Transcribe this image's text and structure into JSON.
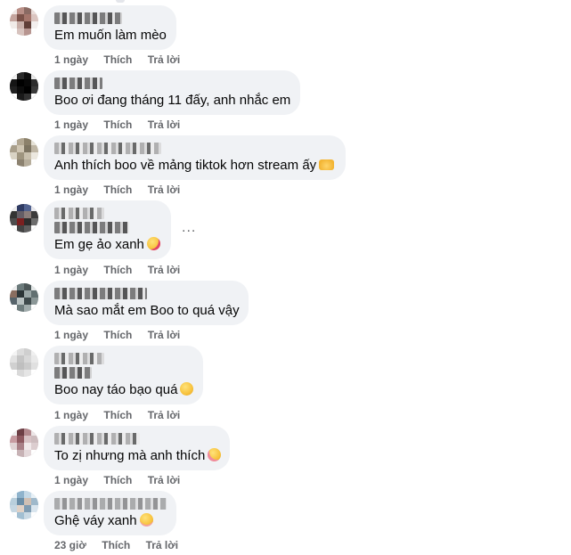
{
  "comments": [
    {
      "text": "Em muốn làm mèo",
      "emoji": "",
      "time": "1 ngày",
      "like": "Thích",
      "reply": "Trả lời"
    },
    {
      "text": "Boo ơi đang tháng 11 đấy, anh nhắc em",
      "emoji": "",
      "time": "1 ngày",
      "like": "Thích",
      "reply": "Trả lời"
    },
    {
      "text": "Anh thích boo về mảng tiktok hơn stream ấy",
      "emoji": "heart-hands-emoji",
      "time": "1 ngày",
      "like": "Thích",
      "reply": "Trả lời"
    },
    {
      "text": "Em gẹ ảo xanh",
      "emoji": "kissing-face-emoji",
      "time": "1 ngày",
      "like": "Thích",
      "reply": "Trả lời",
      "more": "..."
    },
    {
      "text": "Mà sao mắt em Boo to quá vậy",
      "emoji": "",
      "time": "1 ngày",
      "like": "Thích",
      "reply": "Trả lời"
    },
    {
      "text": "Boo nay táo bạo quá",
      "emoji": "grinning-squinting-face-emoji",
      "time": "1 ngày",
      "like": "Thích",
      "reply": "Trả lời"
    },
    {
      "text": "To zị nhưng mà anh thích",
      "emoji": "smiling-face-emoji",
      "time": "1 ngày",
      "like": "Thích",
      "reply": "Trả lời"
    },
    {
      "text": "Ghệ váy xanh",
      "emoji": "flushed-face-emoji",
      "time": "23 giờ",
      "like": "Thích",
      "reply": "Trả lời"
    }
  ]
}
